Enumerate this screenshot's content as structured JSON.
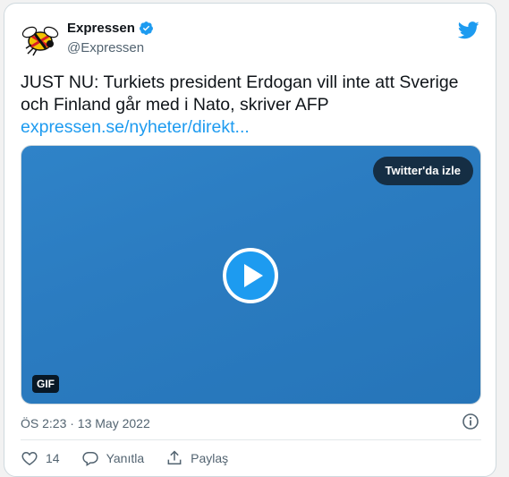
{
  "account": {
    "name": "Expressen",
    "handle": "@Expressen"
  },
  "tweet": {
    "line1": "JUST NU: Turkiets president Erdogan vill inte att Sverige",
    "line2": "och Finland går med i Nato, skriver AFP",
    "link": "expressen.se/nyheter/direkt..."
  },
  "media": {
    "watch_label": "Twitter'da izle",
    "badge": "GIF"
  },
  "timestamp": "ÖS 2:23 · 13 May 2022",
  "actions": {
    "likes": "14",
    "reply_label": "Yanıtla",
    "share_label": "Paylaş"
  },
  "colors": {
    "accent": "#1d9bf0",
    "media_bg": "#2b7cc1"
  },
  "icons": [
    "expressen-logo-icon",
    "verified-icon",
    "twitter-bird-icon",
    "play-icon",
    "info-icon",
    "heart-icon",
    "reply-icon",
    "share-icon"
  ]
}
